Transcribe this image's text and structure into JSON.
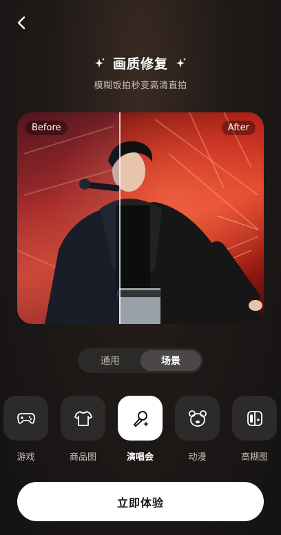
{
  "header": {
    "back_icon": "chevron-left-icon"
  },
  "hero": {
    "title": "画质修复",
    "subtitle": "模糊饭拍秒变高清直拍"
  },
  "preview": {
    "before_label": "Before",
    "after_label": "After"
  },
  "segment": {
    "items": [
      {
        "label": "通用",
        "active": false
      },
      {
        "label": "场景",
        "active": true
      }
    ]
  },
  "categories": [
    {
      "label": "游戏",
      "icon": "gamepad-icon",
      "active": false
    },
    {
      "label": "商品图",
      "icon": "tshirt-icon",
      "active": false
    },
    {
      "label": "演唱会",
      "icon": "microphone-icon",
      "active": true
    },
    {
      "label": "动漫",
      "icon": "bear-icon",
      "active": false
    },
    {
      "label": "高糊图",
      "icon": "switch-console-icon",
      "active": false
    }
  ],
  "cta": {
    "label": "立即体验"
  },
  "colors": {
    "accent": "#ffffff",
    "tile_bg": "#2d2b2a",
    "background": "#1f1a18"
  }
}
